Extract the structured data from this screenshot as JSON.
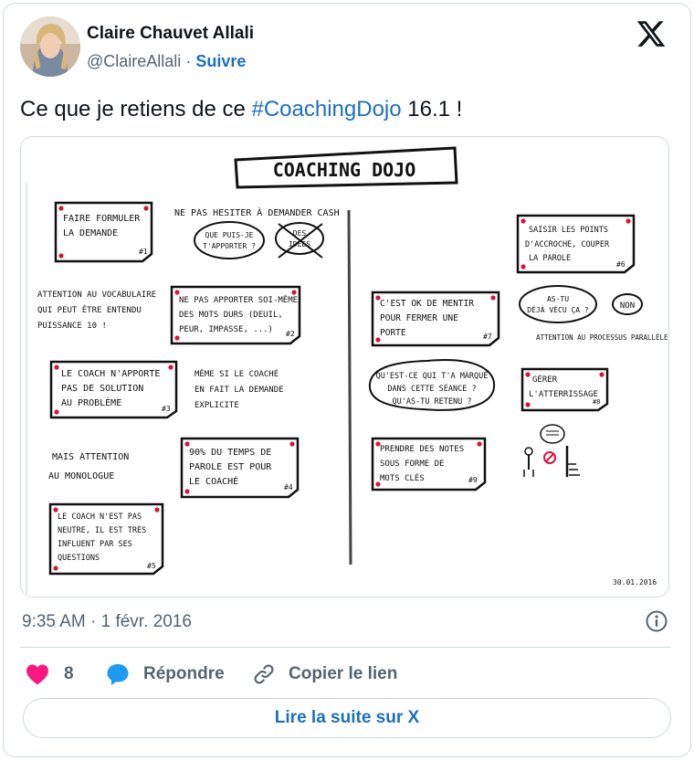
{
  "author": {
    "name": "Claire Chauvet Allali",
    "handle": "@ClaireAllali",
    "separator": "·",
    "follow_label": "Suivre"
  },
  "tweet": {
    "text_before": "Ce que je retiens de ce ",
    "hashtag": "#CoachingDojo",
    "text_after": " 16.1 !"
  },
  "image": {
    "title": "COACHING DOJO",
    "date": "30.01.2016",
    "left": {
      "note1": [
        "FAIRE FORMULER",
        "LA DEMANDE"
      ],
      "note1_num": "#1",
      "header_text": "NE PAS HESITER À DEMANDER CASH",
      "bubble1": [
        "QUE PUIS-JE",
        "T'APPORTER ?"
      ],
      "bubble2": [
        "DES",
        "IDÉES"
      ],
      "text_vocab": [
        "ATTENTION AU VOCABULAIRE",
        "QUI PEUT ÊTRE ENTENDU",
        "PUISSANCE 10 !"
      ],
      "note2": [
        "NE PAS APPORTER SOI-MÊME",
        "DES MOTS DURS (DEUIL,",
        "PEUR, IMPASSE, ...)"
      ],
      "note2_num": "#2",
      "note3": [
        "LE COACH N'APPORTE",
        "PAS DE SOLUTION",
        "AU PROBLÈME"
      ],
      "note3_num": "#3",
      "text_meme": [
        "MÊME SI LE COACHÉ",
        "EN FAIT LA DEMANDE",
        "EXPLICITE"
      ],
      "text_mais": [
        "MAIS ATTENTION",
        "AU MONOLOGUE"
      ],
      "note4": [
        "90% DU TEMPS DE",
        "PAROLE EST POUR",
        "LE COACHÉ"
      ],
      "note4_num": "#4",
      "note5": [
        "LE COACH N'EST PAS",
        "NEUTRE, IL EST TRÈS",
        "INFLUENT PAR SES",
        "QUESTIONS"
      ],
      "note5_num": "#5"
    },
    "right": {
      "note6": [
        "SAISIR LES POINTS",
        "D'ACCROCHE, COUPER",
        "LA PAROLE"
      ],
      "note6_num": "#6",
      "note7": [
        "C'EST OK DE MENTIR",
        "POUR FERMER UNE",
        "PORTE"
      ],
      "note7_num": "#7",
      "bubble3": [
        "AS-TU",
        "DÉJÀ VÉCU ÇA ?"
      ],
      "bubble4": "NON",
      "text_attention": "ATTENTION AU PROCESSUS PARALLÈLE",
      "bubble5": [
        "QU'EST-CE QUI T'A MARQUÉ",
        "DANS CETTE SÉANCE ?",
        "QU'AS-TU RETENU ?"
      ],
      "note8": [
        "GÉRER",
        "L'ATTERRISSAGE"
      ],
      "note8_num": "#8",
      "note9": [
        "PRENDRE DES NOTES",
        "SOUS FORME DE",
        "MOTS CLÉS"
      ],
      "note9_num": "#9"
    }
  },
  "meta": {
    "time": "9:35 AM",
    "separator": "·",
    "date": "1 févr. 2016"
  },
  "actions": {
    "like_count": "8",
    "reply_label": "Répondre",
    "copy_label": "Copier le lien"
  },
  "read_more_label": "Lire la suite sur X",
  "colors": {
    "link": "#1d6fbf",
    "like": "#f91880",
    "reply_icon": "#1d9bf0",
    "muted": "#536471",
    "border": "#cfd9de"
  }
}
